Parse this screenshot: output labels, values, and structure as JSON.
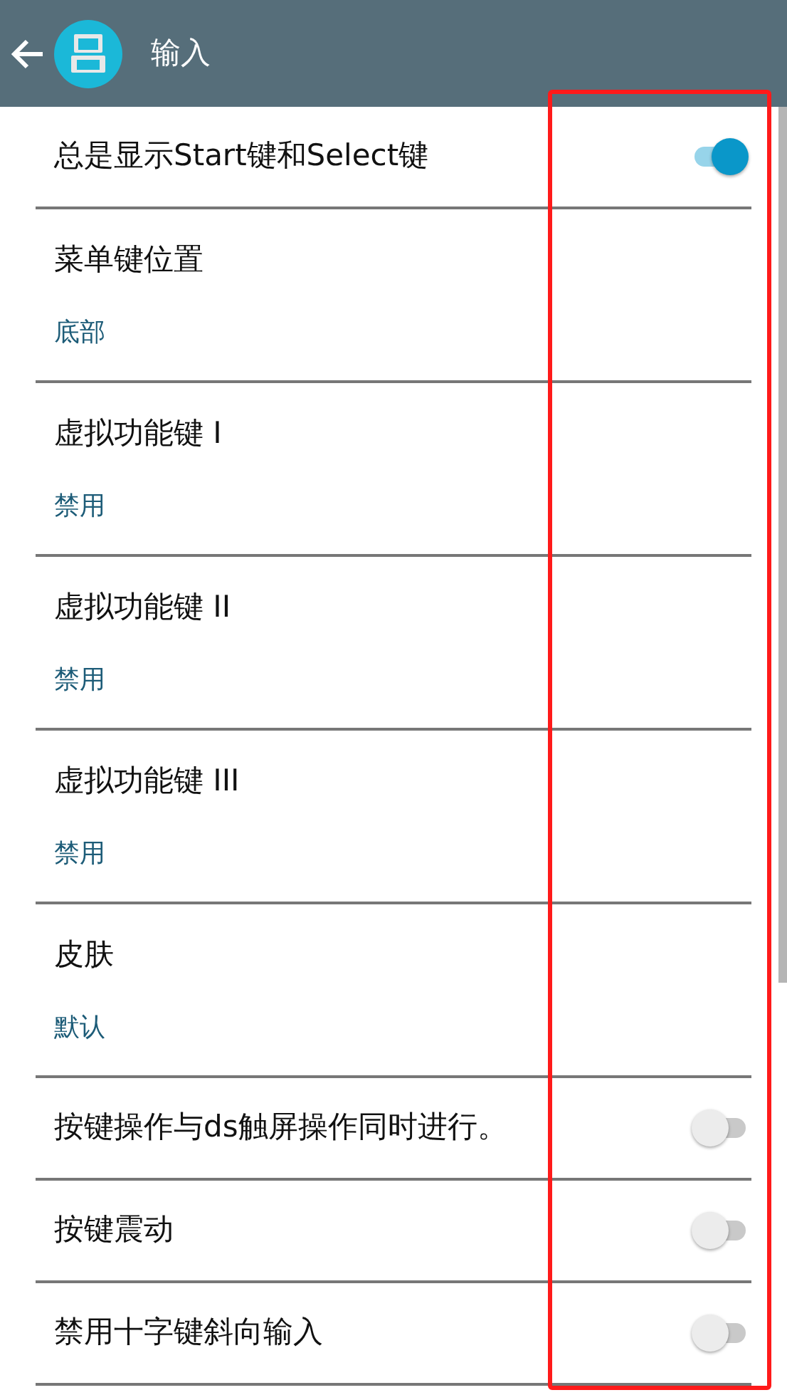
{
  "header": {
    "title": "输入"
  },
  "settings": [
    {
      "kind": "toggle",
      "label": "总是显示Start键和Select键",
      "on": true
    },
    {
      "kind": "choice",
      "label": "菜单键位置",
      "value": "底部"
    },
    {
      "kind": "choice",
      "label": "虚拟功能键 I",
      "value": "禁用"
    },
    {
      "kind": "choice",
      "label": "虚拟功能键 II",
      "value": "禁用"
    },
    {
      "kind": "choice",
      "label": "虚拟功能键 III",
      "value": "禁用"
    },
    {
      "kind": "choice",
      "label": "皮肤",
      "value": "默认"
    },
    {
      "kind": "toggle",
      "label": "按键操作与ds触屏操作同时进行。",
      "on": false
    },
    {
      "kind": "toggle",
      "label": "按键震动",
      "on": false
    },
    {
      "kind": "toggle",
      "label": "禁用十字键斜向输入",
      "on": false
    }
  ],
  "annotation": {
    "kind": "highlight-frame"
  }
}
